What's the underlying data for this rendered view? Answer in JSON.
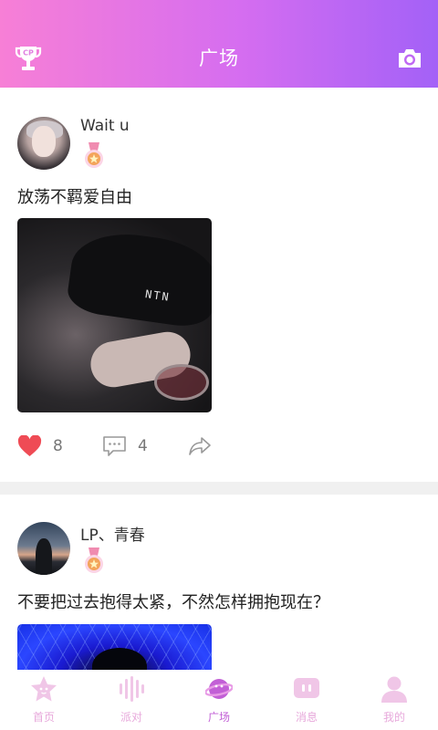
{
  "header": {
    "title": "广场",
    "left_icon": "cp-trophy-icon",
    "right_icon": "camera-icon",
    "gradient": [
      "#f77fd6",
      "#a361f7"
    ]
  },
  "posts": [
    {
      "username": "Wait u",
      "badge_icon": "rank-medal-icon",
      "content": "放荡不羁爱自由",
      "photo_caption_text": "NTN",
      "likes": "8",
      "comments": "4",
      "liked": true
    },
    {
      "username": "LP、青春",
      "badge_icon": "rank-medal-icon",
      "content": "不要把过去抱得太紧，不然怎样拥抱现在？"
    }
  ],
  "tabbar": {
    "items": [
      {
        "label": "首页",
        "icon": "star-face-icon",
        "active": false
      },
      {
        "label": "派对",
        "icon": "sound-wave-icon",
        "active": false
      },
      {
        "label": "广场",
        "icon": "planet-icon",
        "active": true
      },
      {
        "label": "消息",
        "icon": "message-icon",
        "active": false
      },
      {
        "label": "我的",
        "icon": "profile-icon",
        "active": false
      }
    ],
    "inactive_color": "#e7a8db",
    "active_color": "#c25fd6"
  },
  "colors": {
    "like_heart": "#ef4b55",
    "divider": "#f0f0f0"
  }
}
